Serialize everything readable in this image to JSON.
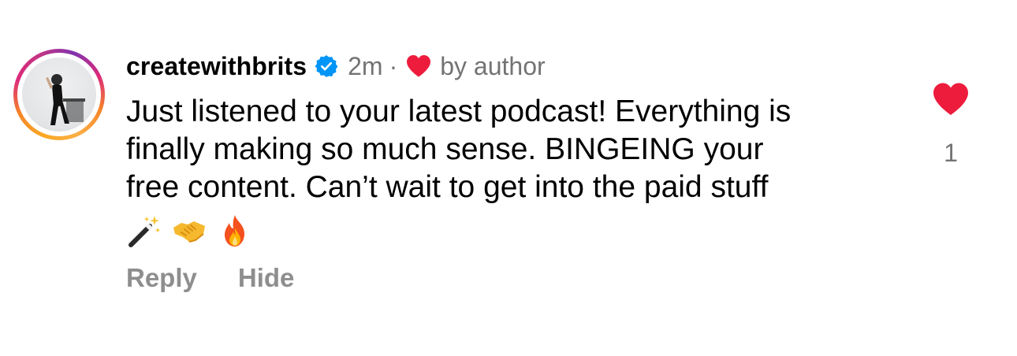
{
  "comment": {
    "username": "createwithbrits",
    "time": "2m",
    "separator": "·",
    "liked_by": "by author",
    "text": "Just listened to your latest podcast! Everything is\nfinally making so much sense. BINGEING your\nfree content. Can’t wait to get into the paid stuff",
    "emojis": [
      "magic-wand",
      "handshake",
      "fire"
    ],
    "actions": {
      "reply": "Reply",
      "hide": "Hide"
    },
    "like_count": "1"
  },
  "icons": {
    "verified": "verified-badge-icon",
    "author_heart": "heart-icon",
    "like": "heart-icon"
  },
  "colors": {
    "heart": "#ed1c3d",
    "verified": "#0095f6",
    "secondary_text": "#737373",
    "action_text": "#8e8e8e"
  }
}
